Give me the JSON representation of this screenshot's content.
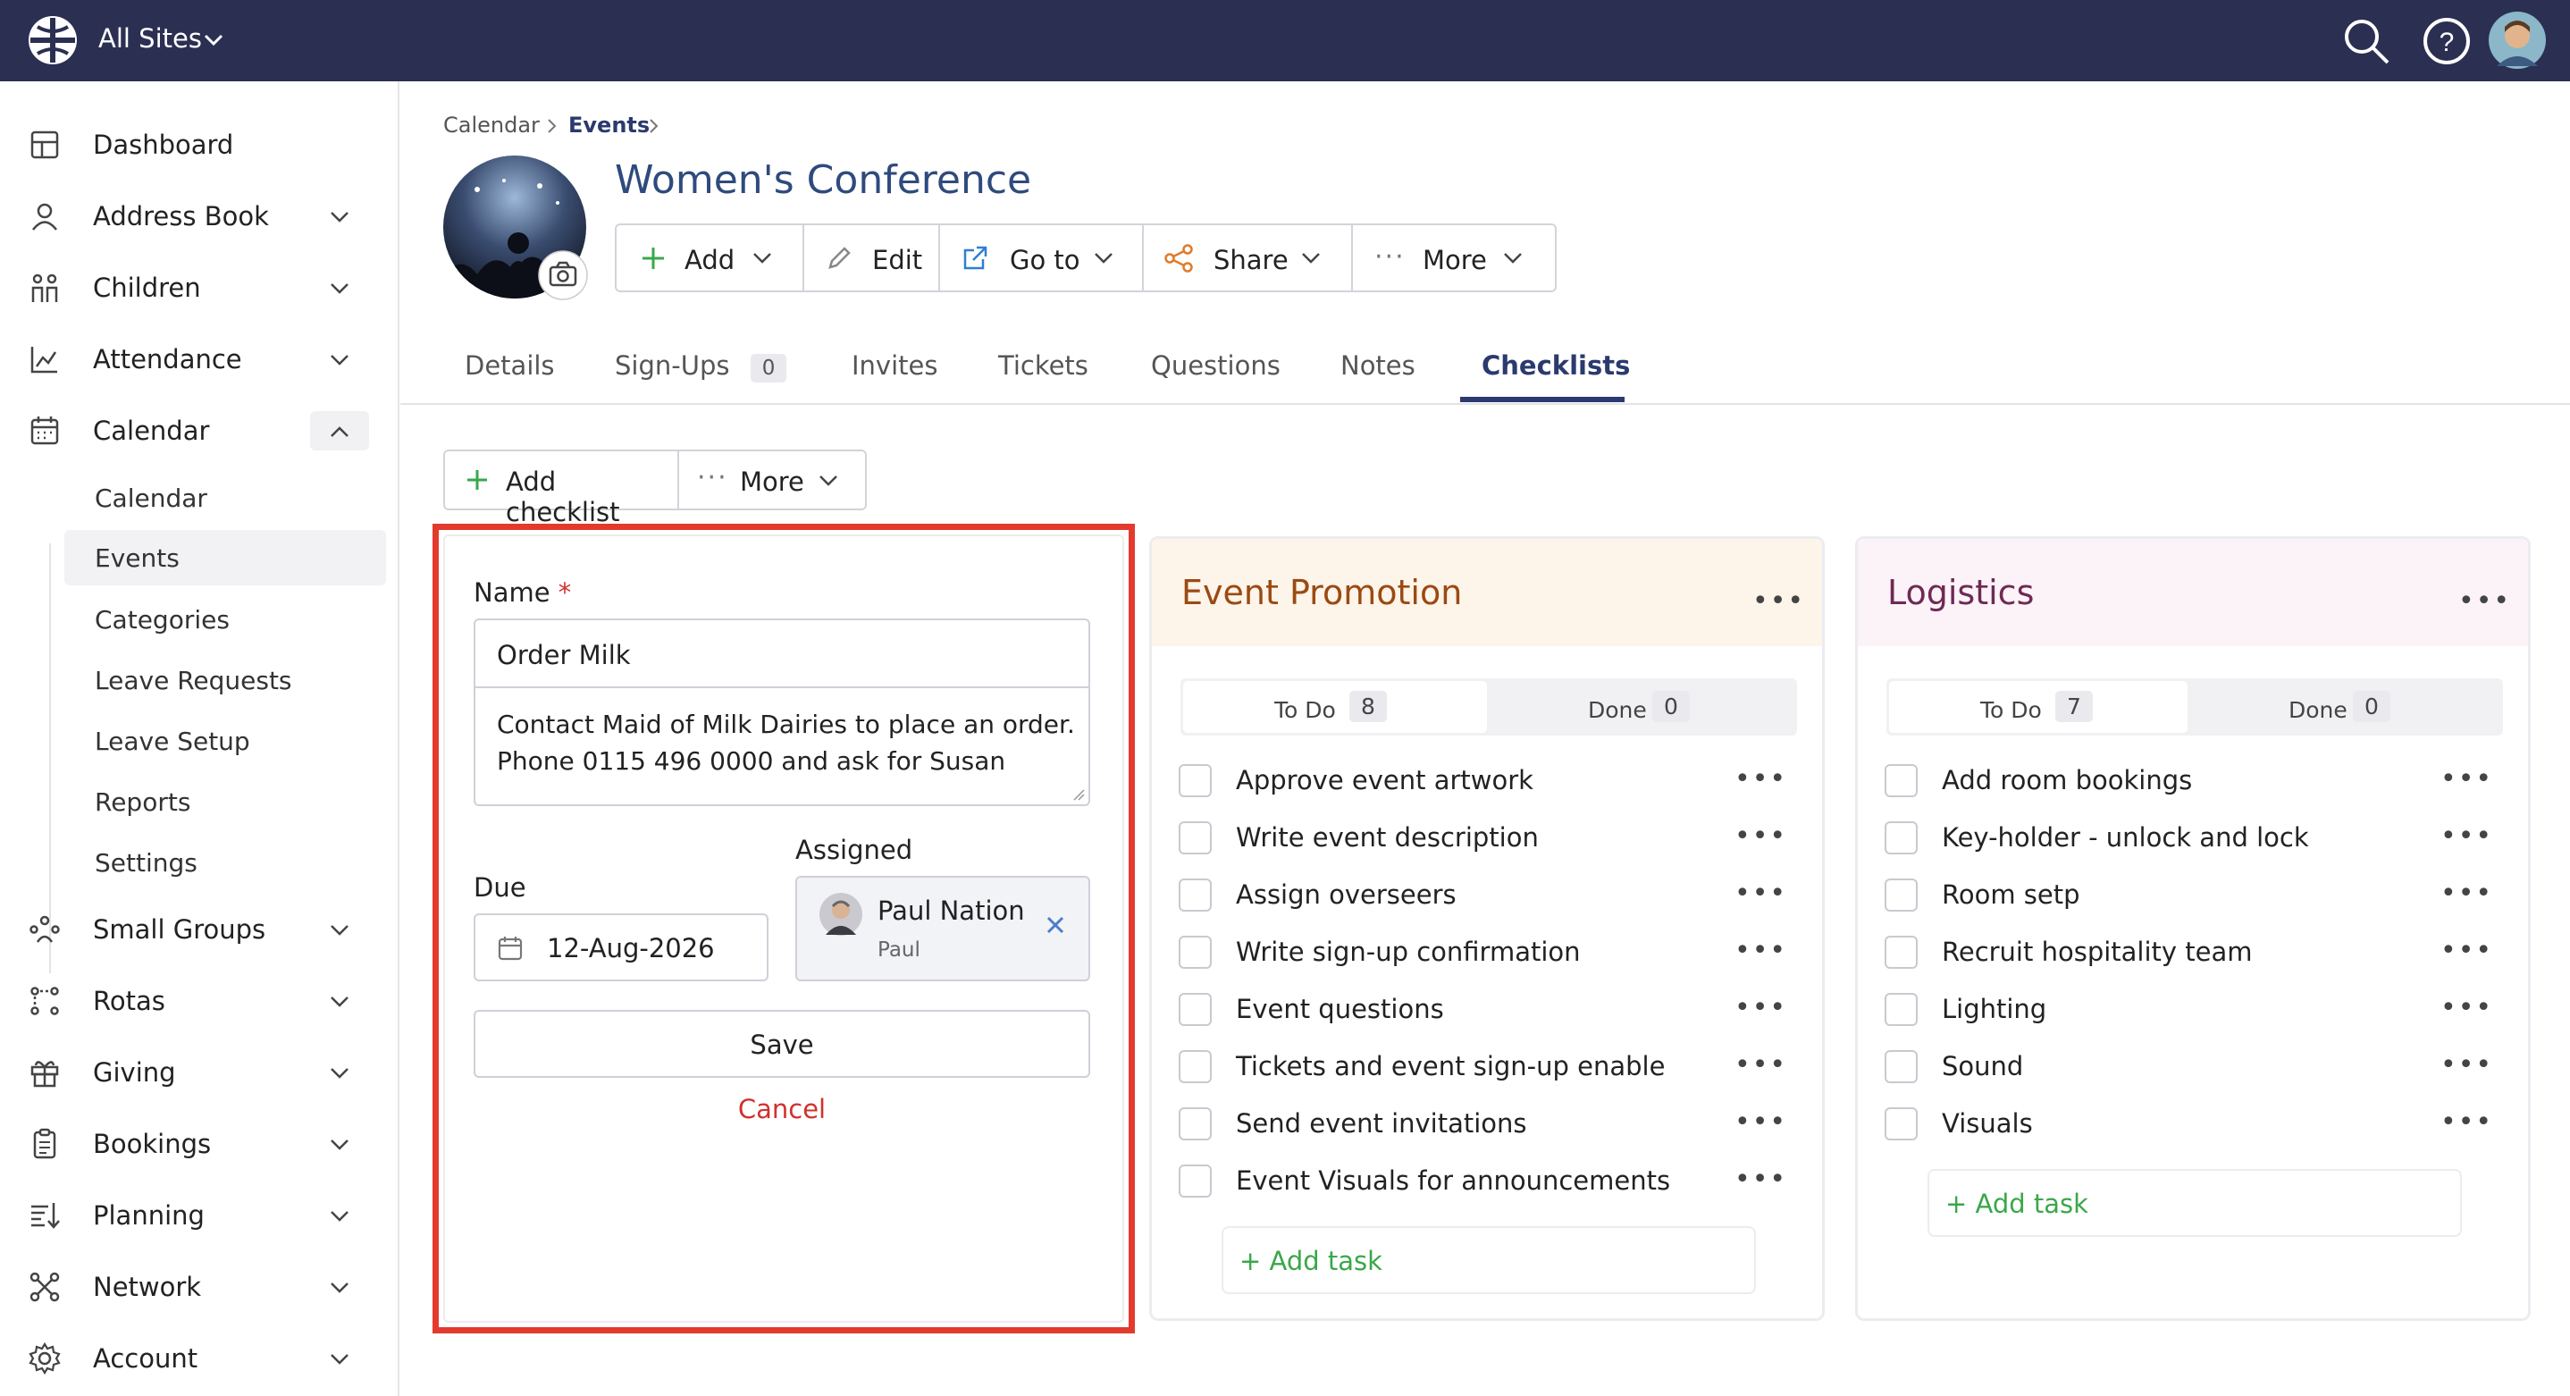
{
  "topbar": {
    "site_selector": "All Sites",
    "icons": [
      "globe-logo-icon",
      "search-icon",
      "help-icon",
      "avatar"
    ]
  },
  "sidebar": {
    "items": [
      {
        "label": "Dashboard",
        "icon": "dashboard-icon"
      },
      {
        "label": "Address Book",
        "icon": "person-icon"
      },
      {
        "label": "Children",
        "icon": "children-icon"
      },
      {
        "label": "Attendance",
        "icon": "chart-icon"
      },
      {
        "label": "Calendar",
        "icon": "calendar-icon",
        "expanded": true
      },
      {
        "label": "Small Groups",
        "icon": "group-icon"
      },
      {
        "label": "Rotas",
        "icon": "rotas-icon"
      },
      {
        "label": "Giving",
        "icon": "gift-icon"
      },
      {
        "label": "Bookings",
        "icon": "clipboard-icon"
      },
      {
        "label": "Planning",
        "icon": "planning-icon"
      },
      {
        "label": "Network",
        "icon": "network-icon"
      },
      {
        "label": "Account",
        "icon": "gear-icon"
      }
    ],
    "calendar_sub": [
      "Calendar",
      "Events",
      "Categories",
      "Leave Requests",
      "Leave Setup",
      "Reports",
      "Settings"
    ],
    "active_sub": "Events"
  },
  "breadcrumb": {
    "items": [
      "Calendar",
      "Events"
    ]
  },
  "page": {
    "title": "Women's Conference"
  },
  "toolbar": {
    "add": "Add",
    "edit": "Edit",
    "goto": "Go to",
    "share": "Share",
    "more": "More"
  },
  "tabs": {
    "details": "Details",
    "signups": "Sign-Ups",
    "signups_count": "0",
    "invites": "Invites",
    "tickets": "Tickets",
    "questions": "Questions",
    "notes": "Notes",
    "checklists": "Checklists",
    "active": "Checklists"
  },
  "actions": {
    "add_checklist": "Add checklist",
    "more": "More"
  },
  "form": {
    "name_label": "Name",
    "required_mark": "*",
    "name_value": "Order Milk",
    "description_line1": "Contact Maid of Milk Dairies to place an order.",
    "description_line2": "Phone 0115 496 0000 and ask for Susan",
    "due_label": "Due",
    "due_value": "12-Aug-2026",
    "assigned_label": "Assigned",
    "assigned_name": "Paul Nation",
    "assigned_sub": "Paul",
    "save": "Save",
    "cancel": "Cancel"
  },
  "checklists": [
    {
      "title": "Event Promotion",
      "todo_label": "To Do",
      "todo_count": "8",
      "done_label": "Done",
      "done_count": "0",
      "tasks": [
        "Approve event artwork",
        "Write event description",
        "Assign overseers",
        "Write sign-up confirmation",
        "Event questions",
        "Tickets and event sign-up enable",
        "Send event invitations",
        "Event Visuals for announcements"
      ],
      "add_task": "+ Add task"
    },
    {
      "title": "Logistics",
      "todo_label": "To Do",
      "todo_count": "7",
      "done_label": "Done",
      "done_count": "0",
      "tasks": [
        "Add room bookings",
        "Key-holder - unlock and lock",
        "Room setp",
        "Recruit hospitality team",
        "Lighting",
        "Sound",
        "Visuals"
      ],
      "add_task": "+ Add task"
    }
  ],
  "colors": {
    "topbar": "#2b2f52",
    "title_blue": "#2f4a7d",
    "tab_active": "#2b3a6e",
    "highlight_border": "#e23b2e",
    "promotion_header": "#fdf4ea",
    "promotion_title": "#9a4a12",
    "logistics_header": "#fbf3f7",
    "logistics_title": "#6e2a55",
    "add_green": "#3aa74a",
    "cancel_red": "#d0312d"
  }
}
